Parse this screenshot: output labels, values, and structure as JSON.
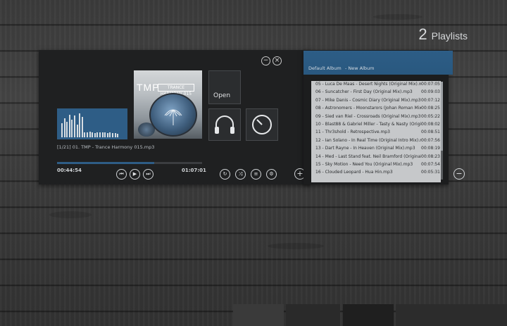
{
  "header": {
    "playlist_count": "2",
    "playlist_label": "Playlists"
  },
  "window": {
    "minimize_glyph": "−",
    "close_glyph": "×"
  },
  "now_playing": {
    "track": "[1/21] 01. TMP - Trance Harmony 015.mp3",
    "elapsed": "00:44:54",
    "total": "01:07:01",
    "progress": 0.67,
    "cover_title": "TMP",
    "cover_subtitle": "TRANCE HARMONY 015",
    "visualizer_levels": [
      0.55,
      0.75,
      0.6,
      0.9,
      0.7,
      0.85,
      0.5,
      0.95,
      0.8,
      0.2,
      0.2,
      0.22,
      0.2,
      0.18,
      0.2,
      0.2,
      0.19,
      0.2,
      0.18,
      0.2,
      0.17,
      0.18,
      0.15
    ]
  },
  "tiles": {
    "open_label": "Open"
  },
  "transport": {
    "prev": "⏮",
    "play": "▶",
    "next": "⏭"
  },
  "tools": {
    "repeat": "↻",
    "shuffle": "⤨",
    "menu": "≡",
    "settings": "⚙"
  },
  "actions": {
    "add": "+",
    "remove": "−"
  },
  "playlists": {
    "tabs": [
      "Default Album",
      "- New Album"
    ],
    "tracks": [
      {
        "name": "05 - Luca De Maas - Desert Nights (Original Mix).mp3",
        "dur": "00:07:05"
      },
      {
        "name": "06 - Suncatcher - First Day (Original Mix).mp3",
        "dur": "00:09:03"
      },
      {
        "name": "07 - Mike Danis - Cosmic Diary (Original Mix).mp3",
        "dur": "00:07:12"
      },
      {
        "name": "08 - Astronomers - Moonstarors (Johan Roman Mix).mp3",
        "dur": "00:08:25"
      },
      {
        "name": "09 - Sied van Riel - Crossroads (Original Mix).mp3",
        "dur": "00:05:22"
      },
      {
        "name": "10 - Blast88 & Gabriel Miller - Tasty & Nasty (Original Mix).mp3",
        "dur": "00:08:02"
      },
      {
        "name": "11 - Thr3shold - Retrospective.mp3",
        "dur": "00:08:51"
      },
      {
        "name": "12 - Ian Solano - In Real Time (Original Intro Mix).mp3",
        "dur": "00:07:56"
      },
      {
        "name": "13 - Dart Rayne - In Heaven (Original Mix).mp3",
        "dur": "00:08:19"
      },
      {
        "name": "14 - Med - Last Stand feat. Neil Bramford (Original Mix).mp3",
        "dur": "00:08:23"
      },
      {
        "name": "15 - Sky Motion - Need You (Original Mix).mp3",
        "dur": "00:07:54"
      },
      {
        "name": "16 - Clouded Leopard - Hua Hin.mp3",
        "dur": "00:05:31"
      }
    ]
  },
  "colors": {
    "accent": "#2e5d86",
    "panel": "#1f2021",
    "list_bg": "#c6c8ca"
  }
}
